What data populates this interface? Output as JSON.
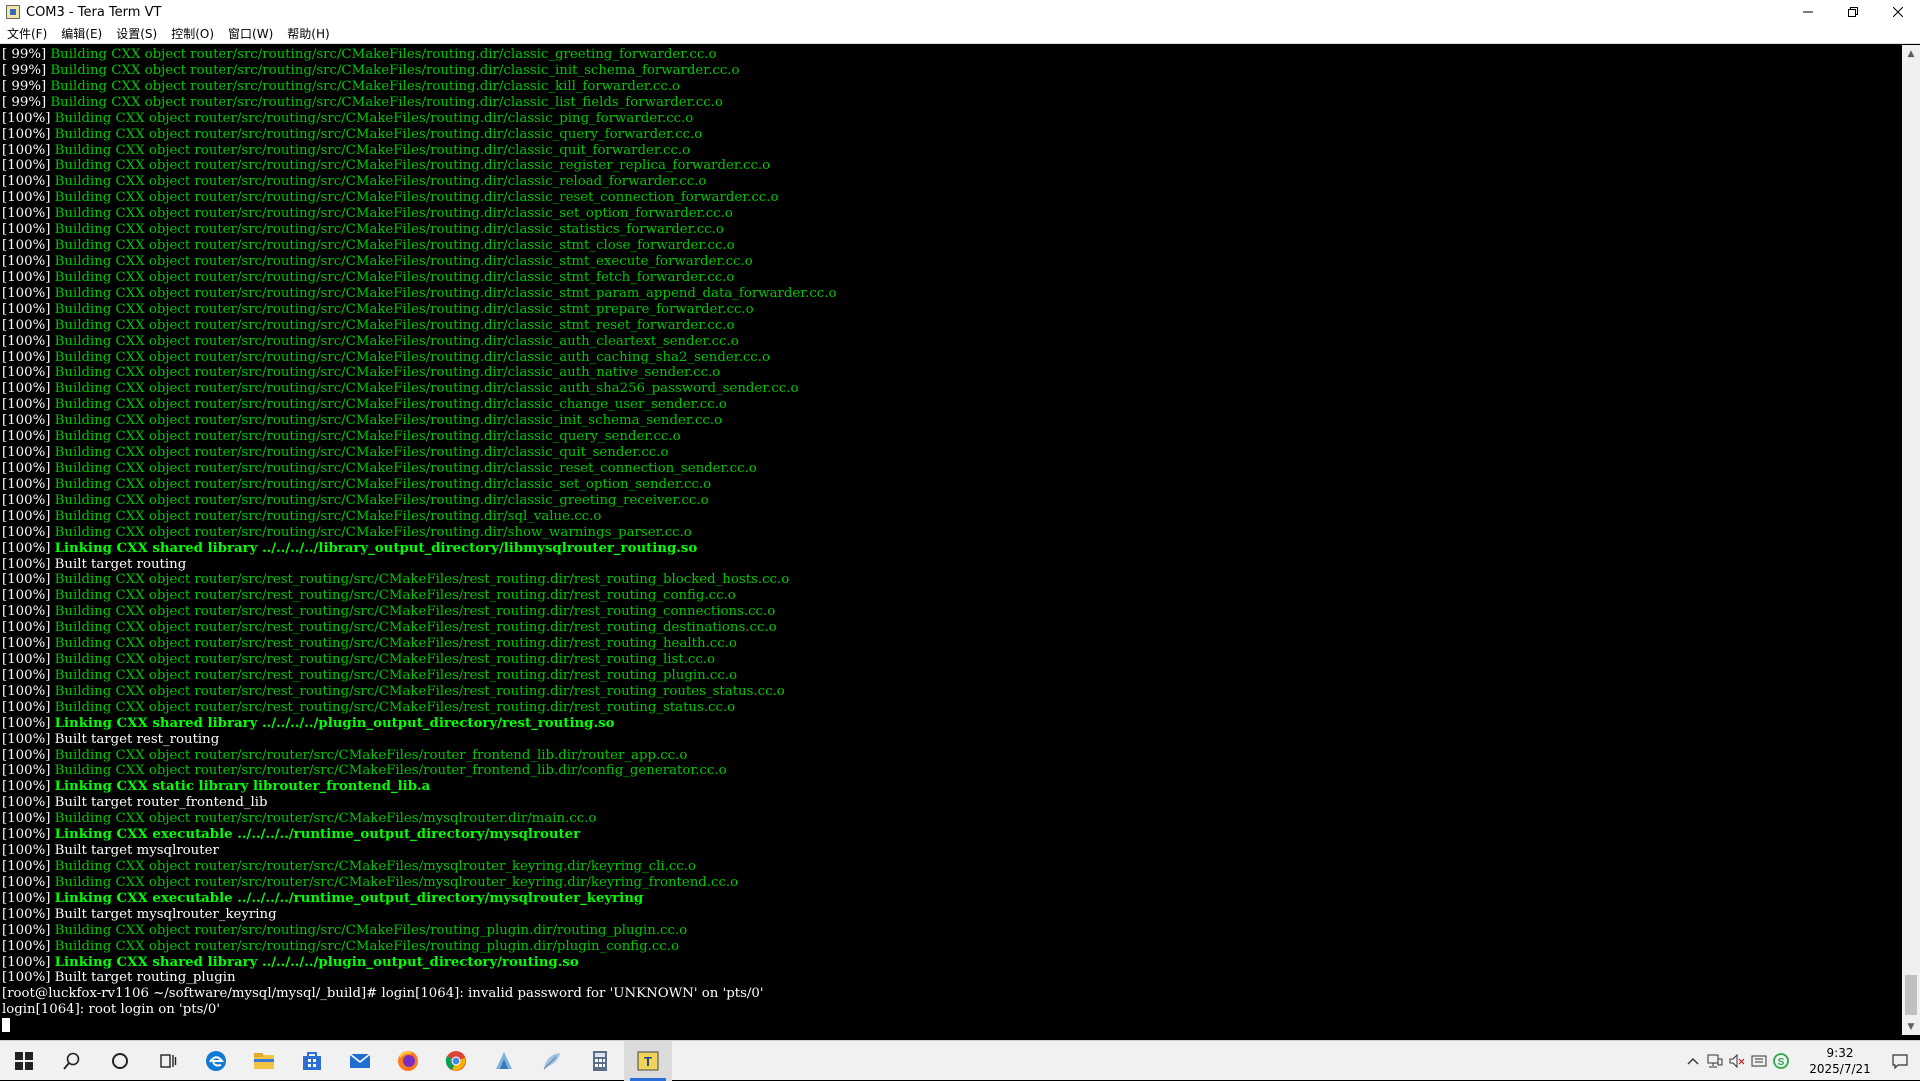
{
  "window": {
    "title": "COM3 - Tera Term VT",
    "controls": {
      "minimize": "—",
      "restore": "❐",
      "close": "✕"
    }
  },
  "menu": [
    "文件(F)",
    "编辑(E)",
    "设置(S)",
    "控制(O)",
    "窗口(W)",
    "帮助(H)"
  ],
  "terminal": {
    "lines": [
      {
        "p": "[ 99%]",
        "m": "Building CXX object router/src/routing/src/CMakeFiles/routing.dir/classic_greeting_forwarder.cc.o",
        "t": "build"
      },
      {
        "p": "[ 99%]",
        "m": "Building CXX object router/src/routing/src/CMakeFiles/routing.dir/classic_init_schema_forwarder.cc.o",
        "t": "build"
      },
      {
        "p": "[ 99%]",
        "m": "Building CXX object router/src/routing/src/CMakeFiles/routing.dir/classic_kill_forwarder.cc.o",
        "t": "build"
      },
      {
        "p": "[ 99%]",
        "m": "Building CXX object router/src/routing/src/CMakeFiles/routing.dir/classic_list_fields_forwarder.cc.o",
        "t": "build"
      },
      {
        "p": "[100%]",
        "m": "Building CXX object router/src/routing/src/CMakeFiles/routing.dir/classic_ping_forwarder.cc.o",
        "t": "build"
      },
      {
        "p": "[100%]",
        "m": "Building CXX object router/src/routing/src/CMakeFiles/routing.dir/classic_query_forwarder.cc.o",
        "t": "build"
      },
      {
        "p": "[100%]",
        "m": "Building CXX object router/src/routing/src/CMakeFiles/routing.dir/classic_quit_forwarder.cc.o",
        "t": "build"
      },
      {
        "p": "[100%]",
        "m": "Building CXX object router/src/routing/src/CMakeFiles/routing.dir/classic_register_replica_forwarder.cc.o",
        "t": "build"
      },
      {
        "p": "[100%]",
        "m": "Building CXX object router/src/routing/src/CMakeFiles/routing.dir/classic_reload_forwarder.cc.o",
        "t": "build"
      },
      {
        "p": "[100%]",
        "m": "Building CXX object router/src/routing/src/CMakeFiles/routing.dir/classic_reset_connection_forwarder.cc.o",
        "t": "build"
      },
      {
        "p": "[100%]",
        "m": "Building CXX object router/src/routing/src/CMakeFiles/routing.dir/classic_set_option_forwarder.cc.o",
        "t": "build"
      },
      {
        "p": "[100%]",
        "m": "Building CXX object router/src/routing/src/CMakeFiles/routing.dir/classic_statistics_forwarder.cc.o",
        "t": "build"
      },
      {
        "p": "[100%]",
        "m": "Building CXX object router/src/routing/src/CMakeFiles/routing.dir/classic_stmt_close_forwarder.cc.o",
        "t": "build"
      },
      {
        "p": "[100%]",
        "m": "Building CXX object router/src/routing/src/CMakeFiles/routing.dir/classic_stmt_execute_forwarder.cc.o",
        "t": "build"
      },
      {
        "p": "[100%]",
        "m": "Building CXX object router/src/routing/src/CMakeFiles/routing.dir/classic_stmt_fetch_forwarder.cc.o",
        "t": "build"
      },
      {
        "p": "[100%]",
        "m": "Building CXX object router/src/routing/src/CMakeFiles/routing.dir/classic_stmt_param_append_data_forwarder.cc.o",
        "t": "build"
      },
      {
        "p": "[100%]",
        "m": "Building CXX object router/src/routing/src/CMakeFiles/routing.dir/classic_stmt_prepare_forwarder.cc.o",
        "t": "build"
      },
      {
        "p": "[100%]",
        "m": "Building CXX object router/src/routing/src/CMakeFiles/routing.dir/classic_stmt_reset_forwarder.cc.o",
        "t": "build"
      },
      {
        "p": "[100%]",
        "m": "Building CXX object router/src/routing/src/CMakeFiles/routing.dir/classic_auth_cleartext_sender.cc.o",
        "t": "build"
      },
      {
        "p": "[100%]",
        "m": "Building CXX object router/src/routing/src/CMakeFiles/routing.dir/classic_auth_caching_sha2_sender.cc.o",
        "t": "build"
      },
      {
        "p": "[100%]",
        "m": "Building CXX object router/src/routing/src/CMakeFiles/routing.dir/classic_auth_native_sender.cc.o",
        "t": "build"
      },
      {
        "p": "[100%]",
        "m": "Building CXX object router/src/routing/src/CMakeFiles/routing.dir/classic_auth_sha256_password_sender.cc.o",
        "t": "build"
      },
      {
        "p": "[100%]",
        "m": "Building CXX object router/src/routing/src/CMakeFiles/routing.dir/classic_change_user_sender.cc.o",
        "t": "build"
      },
      {
        "p": "[100%]",
        "m": "Building CXX object router/src/routing/src/CMakeFiles/routing.dir/classic_init_schema_sender.cc.o",
        "t": "build"
      },
      {
        "p": "[100%]",
        "m": "Building CXX object router/src/routing/src/CMakeFiles/routing.dir/classic_query_sender.cc.o",
        "t": "build"
      },
      {
        "p": "[100%]",
        "m": "Building CXX object router/src/routing/src/CMakeFiles/routing.dir/classic_quit_sender.cc.o",
        "t": "build"
      },
      {
        "p": "[100%]",
        "m": "Building CXX object router/src/routing/src/CMakeFiles/routing.dir/classic_reset_connection_sender.cc.o",
        "t": "build"
      },
      {
        "p": "[100%]",
        "m": "Building CXX object router/src/routing/src/CMakeFiles/routing.dir/classic_set_option_sender.cc.o",
        "t": "build"
      },
      {
        "p": "[100%]",
        "m": "Building CXX object router/src/routing/src/CMakeFiles/routing.dir/classic_greeting_receiver.cc.o",
        "t": "build"
      },
      {
        "p": "[100%]",
        "m": "Building CXX object router/src/routing/src/CMakeFiles/routing.dir/sql_value.cc.o",
        "t": "build"
      },
      {
        "p": "[100%]",
        "m": "Building CXX object router/src/routing/src/CMakeFiles/routing.dir/show_warnings_parser.cc.o",
        "t": "build"
      },
      {
        "p": "[100%]",
        "m": "Linking CXX shared library ../../../../library_output_directory/libmysqlrouter_routing.so",
        "t": "link"
      },
      {
        "p": "[100%]",
        "m": "Built target routing",
        "t": "plain"
      },
      {
        "p": "[100%]",
        "m": "Building CXX object router/src/rest_routing/src/CMakeFiles/rest_routing.dir/rest_routing_blocked_hosts.cc.o",
        "t": "build"
      },
      {
        "p": "[100%]",
        "m": "Building CXX object router/src/rest_routing/src/CMakeFiles/rest_routing.dir/rest_routing_config.cc.o",
        "t": "build"
      },
      {
        "p": "[100%]",
        "m": "Building CXX object router/src/rest_routing/src/CMakeFiles/rest_routing.dir/rest_routing_connections.cc.o",
        "t": "build"
      },
      {
        "p": "[100%]",
        "m": "Building CXX object router/src/rest_routing/src/CMakeFiles/rest_routing.dir/rest_routing_destinations.cc.o",
        "t": "build"
      },
      {
        "p": "[100%]",
        "m": "Building CXX object router/src/rest_routing/src/CMakeFiles/rest_routing.dir/rest_routing_health.cc.o",
        "t": "build"
      },
      {
        "p": "[100%]",
        "m": "Building CXX object router/src/rest_routing/src/CMakeFiles/rest_routing.dir/rest_routing_list.cc.o",
        "t": "build"
      },
      {
        "p": "[100%]",
        "m": "Building CXX object router/src/rest_routing/src/CMakeFiles/rest_routing.dir/rest_routing_plugin.cc.o",
        "t": "build"
      },
      {
        "p": "[100%]",
        "m": "Building CXX object router/src/rest_routing/src/CMakeFiles/rest_routing.dir/rest_routing_routes_status.cc.o",
        "t": "build"
      },
      {
        "p": "[100%]",
        "m": "Building CXX object router/src/rest_routing/src/CMakeFiles/rest_routing.dir/rest_routing_status.cc.o",
        "t": "build"
      },
      {
        "p": "[100%]",
        "m": "Linking CXX shared library ../../../../plugin_output_directory/rest_routing.so",
        "t": "link"
      },
      {
        "p": "[100%]",
        "m": "Built target rest_routing",
        "t": "plain"
      },
      {
        "p": "[100%]",
        "m": "Building CXX object router/src/router/src/CMakeFiles/router_frontend_lib.dir/router_app.cc.o",
        "t": "build"
      },
      {
        "p": "[100%]",
        "m": "Building CXX object router/src/router/src/CMakeFiles/router_frontend_lib.dir/config_generator.cc.o",
        "t": "build"
      },
      {
        "p": "[100%]",
        "m": "Linking CXX static library librouter_frontend_lib.a",
        "t": "link"
      },
      {
        "p": "[100%]",
        "m": "Built target router_frontend_lib",
        "t": "plain"
      },
      {
        "p": "[100%]",
        "m": "Building CXX object router/src/router/src/CMakeFiles/mysqlrouter.dir/main.cc.o",
        "t": "build"
      },
      {
        "p": "[100%]",
        "m": "Linking CXX executable ../../../../runtime_output_directory/mysqlrouter",
        "t": "link"
      },
      {
        "p": "[100%]",
        "m": "Built target mysqlrouter",
        "t": "plain"
      },
      {
        "p": "[100%]",
        "m": "Building CXX object router/src/router/src/CMakeFiles/mysqlrouter_keyring.dir/keyring_cli.cc.o",
        "t": "build"
      },
      {
        "p": "[100%]",
        "m": "Building CXX object router/src/router/src/CMakeFiles/mysqlrouter_keyring.dir/keyring_frontend.cc.o",
        "t": "build"
      },
      {
        "p": "[100%]",
        "m": "Linking CXX executable ../../../../runtime_output_directory/mysqlrouter_keyring",
        "t": "link"
      },
      {
        "p": "[100%]",
        "m": "Built target mysqlrouter_keyring",
        "t": "plain"
      },
      {
        "p": "[100%]",
        "m": "Building CXX object router/src/routing/src/CMakeFiles/routing_plugin.dir/routing_plugin.cc.o",
        "t": "build"
      },
      {
        "p": "[100%]",
        "m": "Building CXX object router/src/routing/src/CMakeFiles/routing_plugin.dir/plugin_config.cc.o",
        "t": "build"
      },
      {
        "p": "[100%]",
        "m": "Linking CXX shared library ../../../../plugin_output_directory/routing.so",
        "t": "link"
      },
      {
        "p": "[100%]",
        "m": "Built target routing_plugin",
        "t": "plain"
      }
    ],
    "prompt_line": "[root@luckfox-rv1106 ~/software/mysql/mysql/_build]# login[1064]: invalid password for 'UNKNOWN' on 'pts/0'",
    "login_line": "login[1064]: root login on 'pts/0'"
  },
  "taskbar": {
    "apps": [
      "start-icon",
      "search-icon",
      "cortana-icon",
      "task-view-icon",
      "edge-icon",
      "file-explorer-icon",
      "store-icon",
      "mail-icon",
      "firefox-icon",
      "chrome-icon",
      "app-blue-icon",
      "app-feather-icon",
      "calculator-icon",
      "teraterm-icon"
    ],
    "clock_time": "9:32",
    "clock_date": "2025/7/21"
  },
  "colors": {
    "build": "#00c800",
    "link": "#00ff00",
    "plain": "#ffffff",
    "background": "#000000"
  }
}
